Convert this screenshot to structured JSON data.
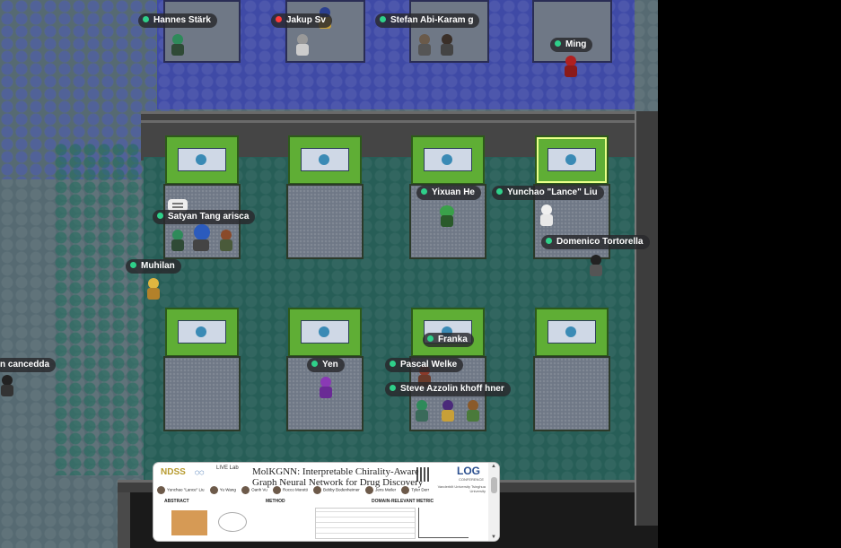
{
  "players": {
    "hannes": "Hannes Stärk",
    "jakup": "Jakup Sv",
    "stefan": "Stefan Abi-Karam g",
    "ming": "Ming",
    "satyan": "Satyan  Tang arisca",
    "yixuan": "Yixuan He",
    "yunchao": "Yunchao \"Lance\" Liu",
    "domenico": "Domenico Tortorella",
    "muhilan": "Muhilan",
    "cancedda": "n cancedda",
    "franka": "Franka",
    "yen": "Yen",
    "pascal": "Pascal Welke",
    "steve": "Steve Azzolin  khoff  hner"
  },
  "poster_preview": {
    "logo_left": "NDSS",
    "logo_lab": "LIVE Lab",
    "title_line1": "MolKGNN: Interpretable Chirality-Aware",
    "title_line2": "Graph Neural Network for Drug Discovery",
    "log_logo": "LOG",
    "conference": "CONFERENCE",
    "university": "Vanderbilt University Tsinghua University",
    "authors": [
      "Yunchao \"Lance\" Liu",
      "Yu Wang",
      "Oanh Vu",
      "Rocco Moretti",
      "Bobby Bodenheimer",
      "Jens Meiler",
      "Tyler Derr"
    ],
    "section_abstract": "ABSTRACT",
    "section_method": "METHOD",
    "section_metric": "DOMAIN-RELEVANT METRIC"
  },
  "colors": {
    "status_available": "#2fd08a",
    "status_busy": "#ff3b3b",
    "booth_screen": "#5fae35"
  },
  "icons": {
    "chat_bubble": "chat-bubble-icon",
    "scroll_up": "▲",
    "scroll_down": "▼"
  }
}
